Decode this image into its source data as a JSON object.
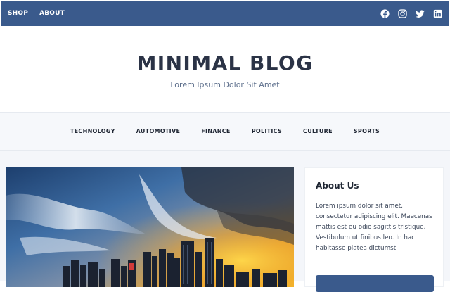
{
  "topbar": {
    "nav": [
      "SHOP",
      "ABOUT"
    ],
    "social_icons": [
      "facebook-icon",
      "instagram-icon",
      "twitter-icon",
      "linkedin-icon"
    ],
    "color": "#3a5a8c"
  },
  "header": {
    "title": "MINIMAL BLOG",
    "tagline": "Lorem Ipsum Dolor Sit Amet"
  },
  "categories": [
    "TECHNOLOGY",
    "AUTOMOTIVE",
    "FINANCE",
    "POLITICS",
    "CULTURE",
    "SPORTS"
  ],
  "featured": {
    "image": "city-skyline-sunset"
  },
  "sidebar": {
    "about_title": "About Us",
    "about_text": "Lorem ipsum dolor sit amet, consectetur adipiscing elit. Maecenas mattis est eu odio sagittis tristique. Vestibulum ut finibus leo. In hac habitasse platea dictumst."
  }
}
